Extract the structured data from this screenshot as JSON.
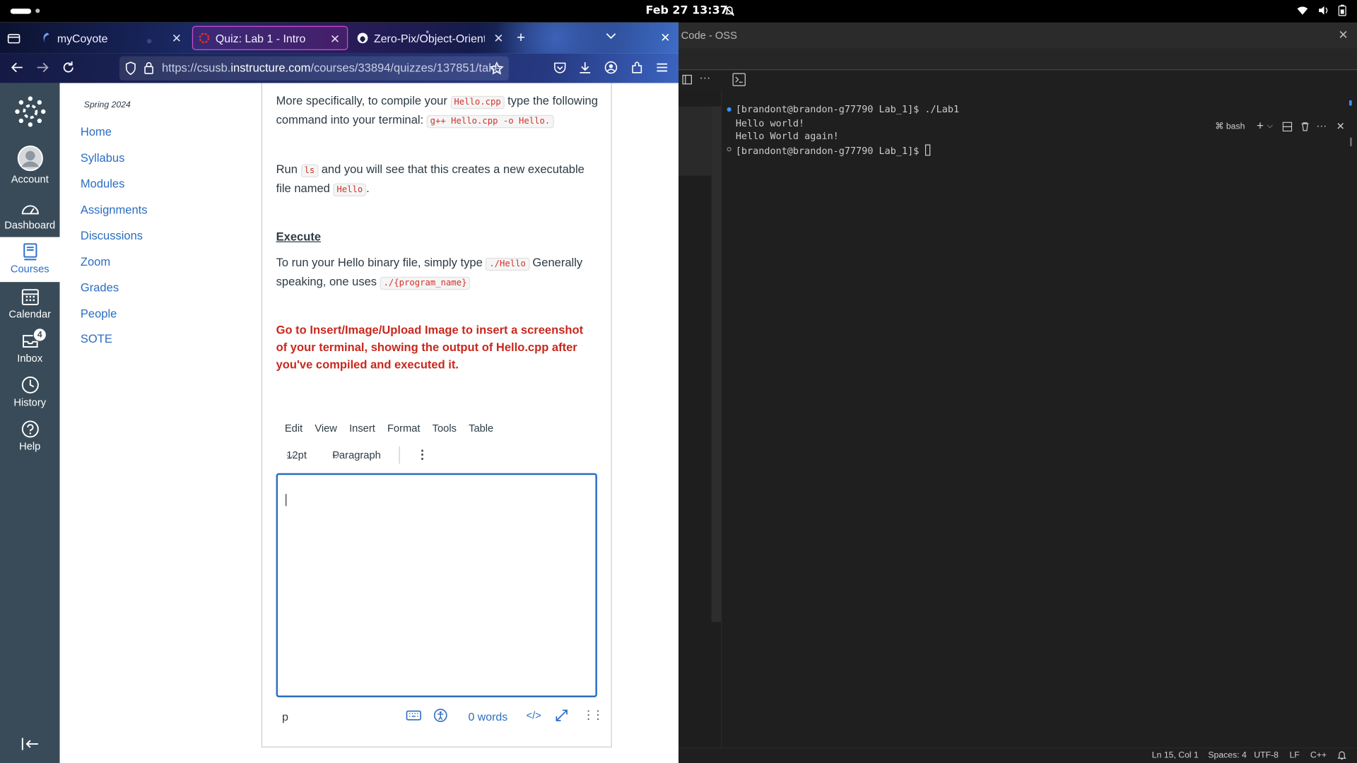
{
  "topbar": {
    "clock": "Feb 27  13:37"
  },
  "browser": {
    "tabs": [
      {
        "label": "myCoyote",
        "icon": "coyote-icon",
        "active": false
      },
      {
        "label": "Quiz: Lab 1 - Intro",
        "icon": "canvas-icon",
        "active": true
      },
      {
        "label": "Zero-Pix/Object-Oriente",
        "icon": "github-icon",
        "active": false
      }
    ],
    "url_prefix": "https://csusb.",
    "url_domain": "instructure.com",
    "url_path": "/courses/33894/quizzes/137851/take"
  },
  "canvas": {
    "global_nav": [
      {
        "label": "Account",
        "icon": "avatar-icon"
      },
      {
        "label": "Dashboard",
        "icon": "dashboard-icon"
      },
      {
        "label": "Courses",
        "icon": "courses-icon",
        "active": true
      },
      {
        "label": "Calendar",
        "icon": "calendar-icon"
      },
      {
        "label": "Inbox",
        "icon": "inbox-icon",
        "badge": "4"
      },
      {
        "label": "History",
        "icon": "history-icon"
      },
      {
        "label": "Help",
        "icon": "help-icon"
      }
    ],
    "term": "Spring 2024",
    "course_nav": [
      "Home",
      "Syllabus",
      "Modules",
      "Assignments",
      "Discussions",
      "Zoom",
      "Grades",
      "People",
      "SOTE"
    ],
    "content": {
      "p1_a": "More specifically, to compile your ",
      "p1_code1": "Hello.cpp",
      "p1_b": " type the following command into your terminal: ",
      "p1_code2": "g++ Hello.cpp -o Hello.",
      "p2_a": "Run ",
      "p2_code1": "ls",
      "p2_b": " and you will see that this creates a new executable file named ",
      "p2_code2": "Hello",
      "p2_c": ".",
      "heading": "Execute",
      "p3_a": "To run your Hello binary file, simply type ",
      "p3_code1": "./Hello",
      "p3_b": " Generally speaking, one uses ",
      "p3_code2": "./{program_name}",
      "note": "Go to Insert/Image/Upload  Image to insert a screenshot of your terminal, showing the output of Hello.cpp after you've compiled and executed it."
    },
    "editor": {
      "menu": [
        "Edit",
        "View",
        "Insert",
        "Format",
        "Tools",
        "Table"
      ],
      "font_size": "12pt",
      "block": "Paragraph",
      "path": "p",
      "word_count": "0 words",
      "html_toggle": "</>"
    }
  },
  "vscode": {
    "title": "Code - OSS",
    "terminal_name": "bash",
    "lines": [
      "[brandont@brandon-g77790 Lab_1]$ ./Lab1",
      "Hello world!",
      "Hello World again!",
      "[brandont@brandon-g77790 Lab_1]$ "
    ],
    "status": {
      "position": "Ln 15, Col 1",
      "spaces": "Spaces: 4",
      "encoding": "UTF-8",
      "eol": "LF",
      "language": "C++"
    }
  }
}
